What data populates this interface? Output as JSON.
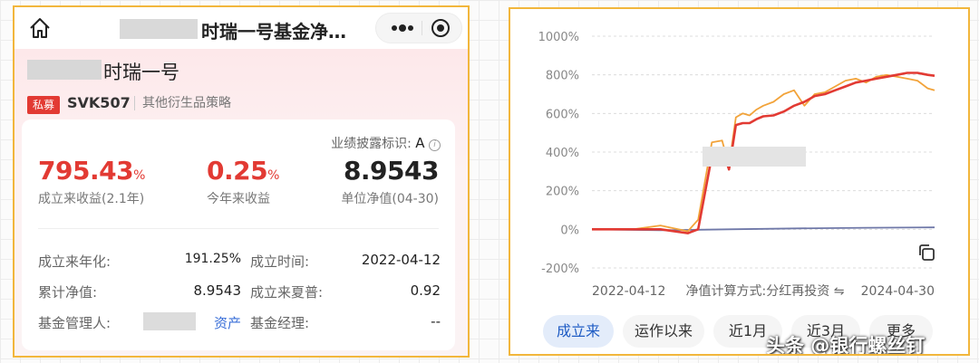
{
  "header": {
    "title": "时瑞一号基金净…",
    "icons": [
      "home-icon",
      "more-icon",
      "target-icon"
    ]
  },
  "fund": {
    "name": "时瑞一号",
    "badge": "私募",
    "code": "SVK507",
    "strategy": "其他衍生品策略",
    "disclosure_label": "业绩披露标识:",
    "disclosure_value": "A",
    "stats": [
      {
        "value": "795.43",
        "unit": "%",
        "label": "成立来收益(2.1年)"
      },
      {
        "value": "0.25",
        "unit": "%",
        "label": "今年来收益"
      },
      {
        "value": "8.9543",
        "unit": "",
        "label": "单位净值(04-30)"
      }
    ],
    "details": [
      {
        "label": "成立来年化:",
        "value": "191.25%"
      },
      {
        "label": "成立时间:",
        "value": "2022-04-12"
      },
      {
        "label": "累计净值:",
        "value": "8.9543"
      },
      {
        "label": "成立来夏普:",
        "value": "0.92"
      },
      {
        "label": "基金管理人:",
        "value": "资产"
      },
      {
        "label": "基金经理:",
        "value": "--"
      }
    ]
  },
  "colors": {
    "accent": "#e23a33",
    "benchmark": "#f2a33a",
    "index": "#6f78a8",
    "tab_active": "#1f5cc4"
  },
  "chart_data": {
    "type": "line",
    "ylim": [
      -200,
      1000
    ],
    "yticks": [
      "1000%",
      "800%",
      "600%",
      "400%",
      "200%",
      "0%",
      "-200%"
    ],
    "xlabels": [
      "2022-04-12",
      "2024-04-30"
    ],
    "method_label": "净值计算方式:分红再投资",
    "series": [
      {
        "color": "#e23a33",
        "x": [
          0.0,
          0.12,
          0.2,
          0.28,
          0.31,
          0.35,
          0.38,
          0.4,
          0.42,
          0.44,
          0.46,
          0.48,
          0.5,
          0.53,
          0.56,
          0.59,
          0.62,
          0.65,
          0.68,
          0.71,
          0.74,
          0.77,
          0.8,
          0.83,
          0.86,
          0.89,
          0.92,
          0.95,
          0.98,
          1.0
        ],
        "y": [
          0,
          0,
          0,
          -20,
          0,
          380,
          420,
          310,
          540,
          550,
          550,
          570,
          585,
          590,
          610,
          640,
          660,
          690,
          700,
          720,
          740,
          760,
          770,
          780,
          790,
          800,
          810,
          810,
          800,
          795
        ]
      },
      {
        "color": "#f2a33a",
        "x": [
          0.0,
          0.12,
          0.2,
          0.28,
          0.31,
          0.35,
          0.38,
          0.4,
          0.42,
          0.44,
          0.46,
          0.48,
          0.5,
          0.53,
          0.56,
          0.59,
          0.62,
          0.65,
          0.68,
          0.71,
          0.74,
          0.77,
          0.8,
          0.83,
          0.86,
          0.89,
          0.92,
          0.95,
          0.98,
          1.0
        ],
        "y": [
          0,
          0,
          20,
          -10,
          50,
          450,
          460,
          330,
          580,
          600,
          590,
          620,
          640,
          660,
          700,
          720,
          640,
          700,
          710,
          740,
          770,
          780,
          760,
          790,
          800,
          790,
          780,
          770,
          730,
          720
        ]
      },
      {
        "color": "#6f78a8",
        "x": [
          0.0,
          0.2,
          0.4,
          0.6,
          0.8,
          1.0
        ],
        "y": [
          0,
          -5,
          0,
          5,
          8,
          10
        ]
      }
    ]
  },
  "tabs": [
    "成立来",
    "运作以来",
    "近1月",
    "近3月",
    "更多"
  ],
  "watermark": "头条 @银行螺丝钉"
}
